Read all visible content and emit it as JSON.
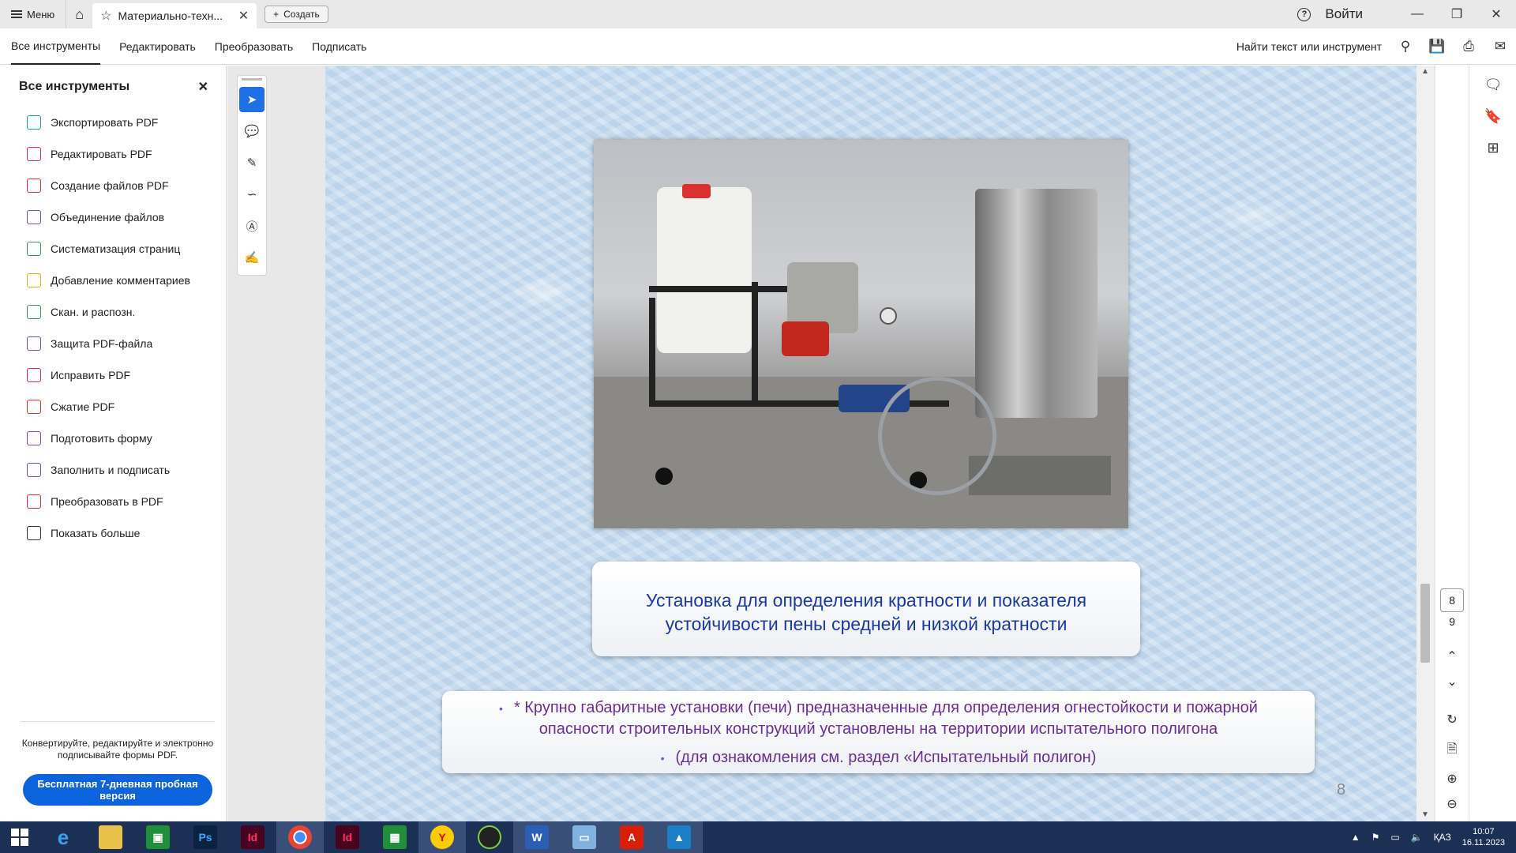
{
  "titlebar": {
    "menu_label": "Меню",
    "tab_title": "Материально-техн...",
    "create_label": "Создать",
    "signin_label": "Войти"
  },
  "toolbar": {
    "items": [
      "Все инструменты",
      "Редактировать",
      "Преобразовать",
      "Подписать"
    ],
    "find_label": "Найти текст или инструмент"
  },
  "left_panel": {
    "title": "Все инструменты",
    "tools": [
      {
        "label": "Экспортировать PDF",
        "icon": "export-pdf-icon",
        "color": "#19a0a0"
      },
      {
        "label": "Редактировать PDF",
        "icon": "edit-pdf-icon",
        "color": "#e0285a"
      },
      {
        "label": "Создание файлов PDF",
        "icon": "create-pdf-icon",
        "color": "#e03030"
      },
      {
        "label": "Объединение файлов",
        "icon": "combine-files-icon",
        "color": "#6a4de0"
      },
      {
        "label": "Систематизация страниц",
        "icon": "organize-pages-icon",
        "color": "#2aa04a"
      },
      {
        "label": "Добавление комментариев",
        "icon": "comment-icon",
        "color": "#e8b000"
      },
      {
        "label": "Скан. и распозн.",
        "icon": "scan-ocr-icon",
        "color": "#2aa04a"
      },
      {
        "label": "Защита PDF-файла",
        "icon": "protect-pdf-icon",
        "color": "#6a4de0"
      },
      {
        "label": "Исправить PDF",
        "icon": "redact-pdf-icon",
        "color": "#e0285a"
      },
      {
        "label": "Сжатие PDF",
        "icon": "compress-pdf-icon",
        "color": "#e03030"
      },
      {
        "label": "Подготовить форму",
        "icon": "prepare-form-icon",
        "color": "#8a3de0"
      },
      {
        "label": "Заполнить и подписать",
        "icon": "fill-sign-icon",
        "color": "#6a4de0"
      },
      {
        "label": "Преобразовать в PDF",
        "icon": "convert-pdf-icon",
        "color": "#e03030"
      },
      {
        "label": "Показать больше",
        "icon": "wrench-icon",
        "color": "#333333"
      }
    ],
    "promo_text": "Конвертируйте, редактируйте и электронно подписывайте формы PDF.",
    "trial_button": "Бесплатная 7-дневная пробная версия"
  },
  "slide": {
    "caption_line1": "Установка для определения кратности и показателя",
    "caption_line2": "устойчивости пены средней и низкой кратности",
    "note_line1": "* Крупно габаритные установки (печи) предназначенные для определения огнестойкости и пожарной",
    "note_line1b": "опасности строительных конструкций установлены на территории испытательного полигона",
    "note_line2": "(для ознакомления см. раздел «Испытательный полигон)",
    "slide_number": "8"
  },
  "navigation": {
    "current_page": "8",
    "total_pages": "9"
  },
  "taskbar": {
    "lang": "ҚАЗ",
    "time": "10:07",
    "date": "16.11.2023"
  },
  "colors": {
    "accent": "#0d63dc",
    "caption_text": "#1a3aa6",
    "note_text": "#6a2d9a",
    "taskbar": "#1c2f54"
  }
}
